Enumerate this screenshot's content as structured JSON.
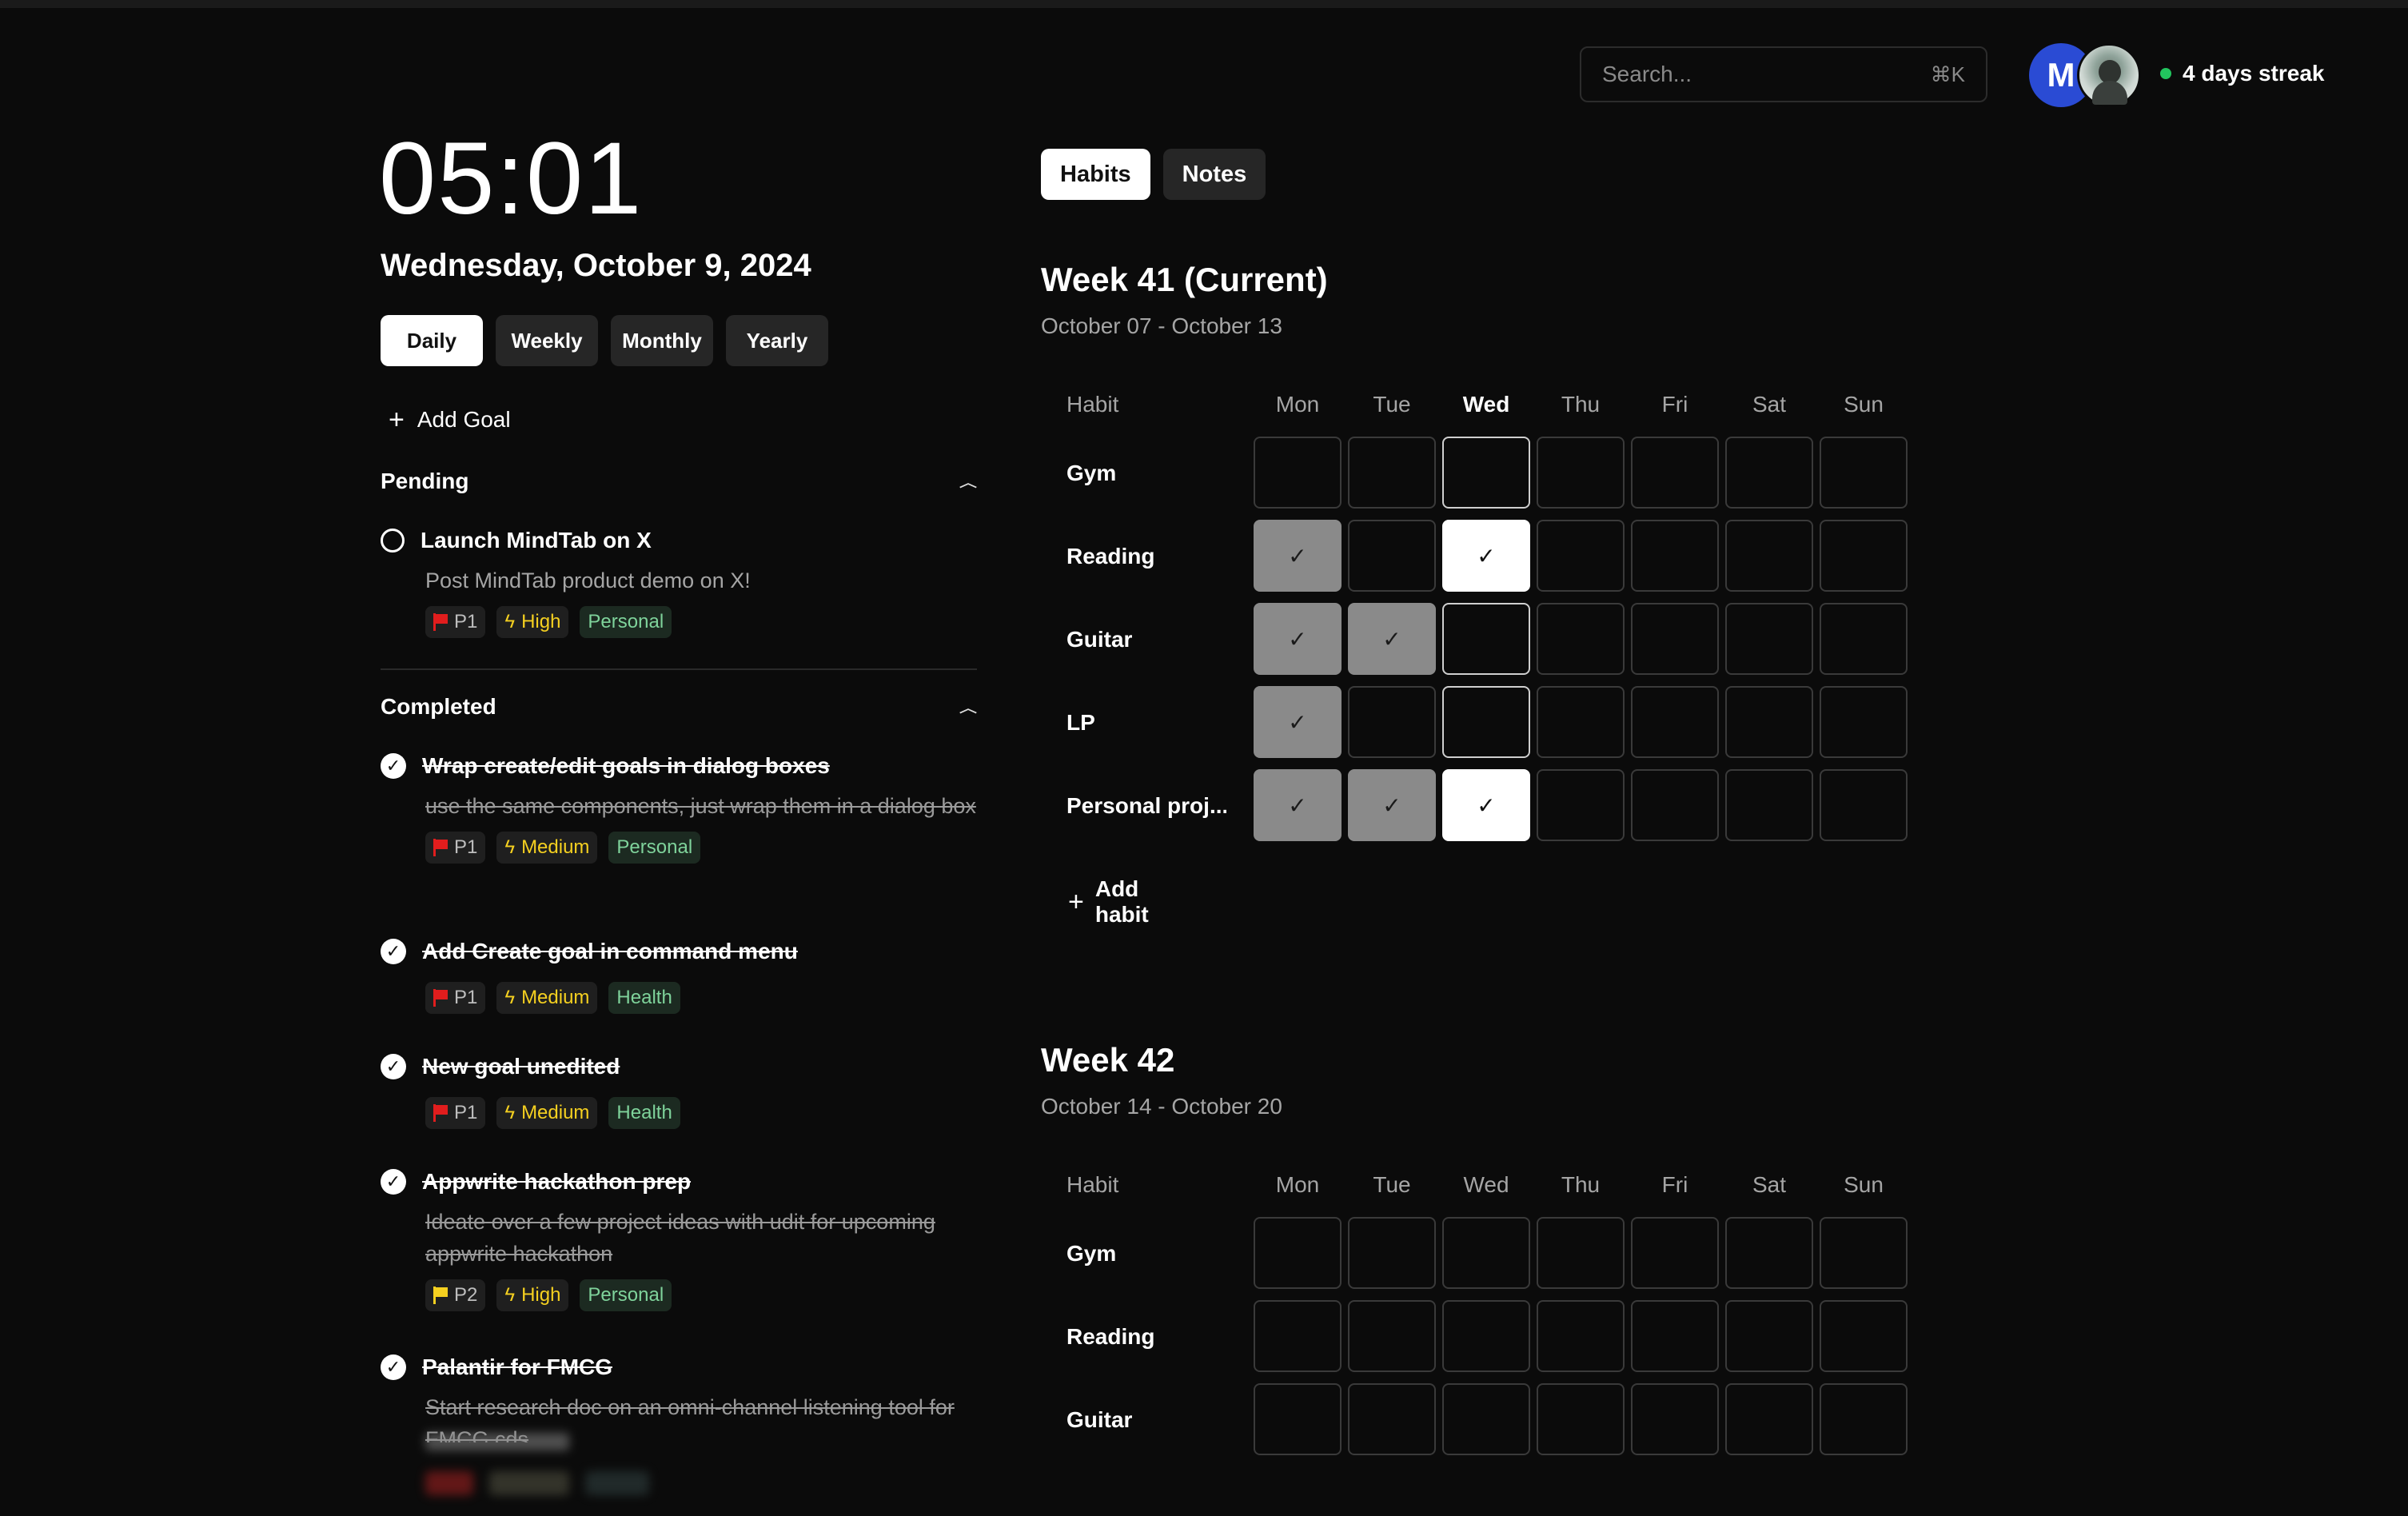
{
  "header": {
    "search_placeholder": "Search...",
    "search_shortcut": "⌘K",
    "avatar_initial": "M",
    "streak": "4 days streak"
  },
  "left": {
    "time": "05:01",
    "date": "Wednesday, October 9, 2024",
    "ranges": [
      "Daily",
      "Weekly",
      "Monthly",
      "Yearly"
    ],
    "add_goal": "Add Goal",
    "pending_label": "Pending",
    "completed_label": "Completed",
    "pending": [
      {
        "title": "Launch MindTab on X",
        "desc": "Post MindTab product demo on X!",
        "priority": "P1",
        "level": "High",
        "category": "Personal"
      }
    ],
    "completed": [
      {
        "title": "Wrap create/edit goals in dialog boxes",
        "desc": "use the same components, just wrap them in a dialog box",
        "priority": "P1",
        "level": "Medium",
        "category": "Personal"
      },
      {
        "title": "Add Create goal in command menu",
        "priority": "P1",
        "level": "Medium",
        "category": "Health"
      },
      {
        "title": "New goal unedited",
        "priority": "P1",
        "level": "Medium",
        "category": "Health"
      },
      {
        "title": "Appwrite hackathon prep",
        "desc": "Ideate over a few project ideas with udit for upcoming appwrite hackathon",
        "priority": "P2",
        "level": "High",
        "category": "Personal"
      },
      {
        "title": "Palantir for FMCG",
        "desc": "Start research doc on an omni-channel listening tool for FMCG cds"
      }
    ]
  },
  "right": {
    "tabs": [
      "Habits",
      "Notes"
    ],
    "habit_col": "Habit",
    "days": [
      "Mon",
      "Tue",
      "Wed",
      "Thu",
      "Fri",
      "Sat",
      "Sun"
    ],
    "add_habit": "Add habit",
    "week41": {
      "title": "Week 41 (Current)",
      "range": "October 07 - October 13",
      "habits": [
        {
          "name": "Gym",
          "checks": [
            0,
            0,
            0,
            0,
            0,
            0,
            0
          ]
        },
        {
          "name": "Reading",
          "checks": [
            1,
            0,
            1,
            0,
            0,
            0,
            0
          ]
        },
        {
          "name": "Guitar",
          "checks": [
            1,
            1,
            0,
            0,
            0,
            0,
            0
          ]
        },
        {
          "name": "LP",
          "checks": [
            1,
            0,
            0,
            0,
            0,
            0,
            0
          ]
        },
        {
          "name": "Personal proj...",
          "checks": [
            1,
            1,
            1,
            0,
            0,
            0,
            0
          ]
        }
      ]
    },
    "week42": {
      "title": "Week 42",
      "range": "October 14 - October 20",
      "habits": [
        {
          "name": "Gym",
          "checks": [
            0,
            0,
            0,
            0,
            0,
            0,
            0
          ]
        },
        {
          "name": "Reading",
          "checks": [
            0,
            0,
            0,
            0,
            0,
            0,
            0
          ]
        },
        {
          "name": "Guitar",
          "checks": [
            0,
            0,
            0,
            0,
            0,
            0,
            0
          ]
        }
      ]
    }
  },
  "colors": {
    "background": "#0b0b0b",
    "accent_avatar": "#2a4bd4",
    "streak_dot": "#22c55e",
    "flag_p1": "#e11d1d",
    "flag_p2": "#f5d020",
    "level": "#f5d020",
    "category": "#7fd39b"
  }
}
